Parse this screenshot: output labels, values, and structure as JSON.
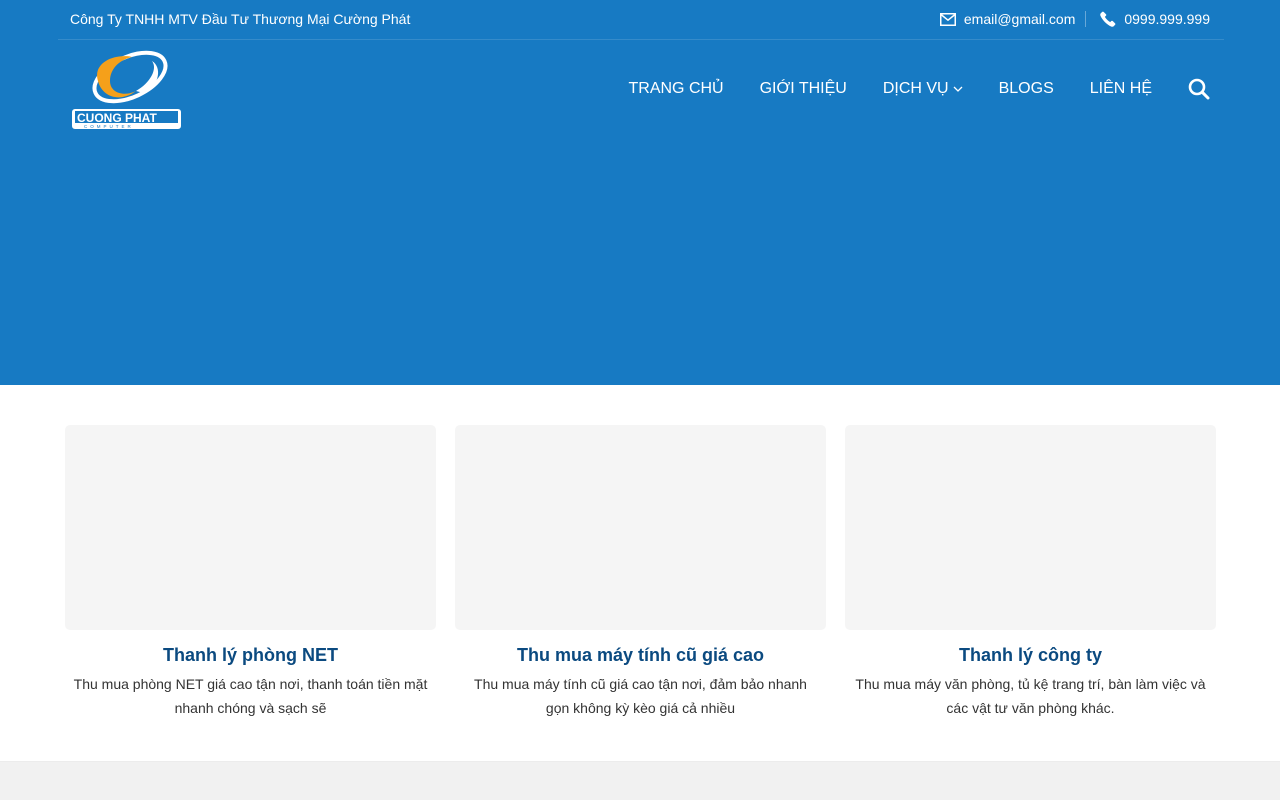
{
  "topbar": {
    "company": "Công Ty TNHH MTV Đầu Tư Thương Mại Cường Phát",
    "email": "email@gmail.com",
    "phone": "0999.999.999",
    "email_icon": "envelope-icon",
    "phone_icon": "phone-icon"
  },
  "logo": {
    "text": "CUONG PHAT",
    "subtext": "COMPUTER",
    "colors": {
      "orange": "#f5a01a",
      "white": "#ffffff"
    }
  },
  "nav": {
    "items": [
      "TRANG CHỦ",
      "GIỚI THIỆU",
      "DỊCH VỤ",
      "BLOGS",
      "LIÊN HỆ"
    ],
    "search_icon": "search-icon"
  },
  "cards": [
    {
      "title": "Thanh lý phòng NET",
      "desc": "Thu mua phòng NET giá cao tận nơi, thanh toán tiền mặt nhanh chóng và sạch sẽ"
    },
    {
      "title": "Thu mua máy tính cũ giá cao",
      "desc": "Thu mua máy tính cũ giá cao tận nơi, đảm bảo nhanh gọn không kỳ kèo giá cả nhiều"
    },
    {
      "title": "Thanh lý công ty",
      "desc": "Thu mua máy văn phòng, tủ kệ trang trí, bàn làm việc và các vật tư văn phòng khác."
    }
  ],
  "colors": {
    "header_bg": "#177ac3",
    "card_title": "#0b4a80",
    "card_image_bg": "#f5f5f5"
  }
}
